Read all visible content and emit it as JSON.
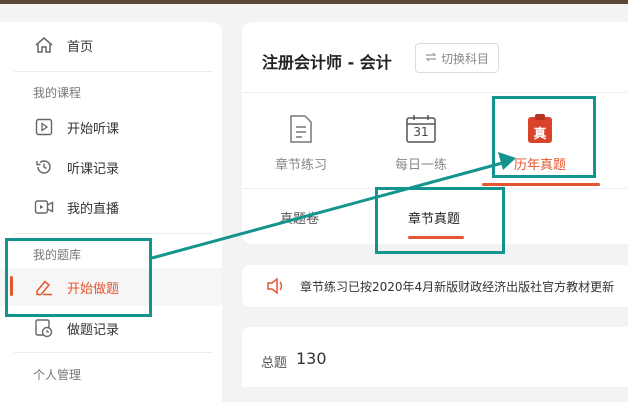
{
  "sidebar": {
    "home_label": "首页",
    "section_courses": "我的课程",
    "start_listen_label": "开始听课",
    "listen_history_label": "听课记录",
    "my_live_label": "我的直播",
    "section_question_bank": "我的题库",
    "start_practice_label": "开始做题",
    "practice_history_label": "做题记录",
    "section_personal": "个人管理"
  },
  "header": {
    "title": "注册会计师 - 会计",
    "switch_subject_label": "切换科目"
  },
  "tabs": [
    {
      "label": "章节练习",
      "icon": "document-icon"
    },
    {
      "label": "每日一练",
      "icon": "calendar-icon",
      "icon_text": "31"
    },
    {
      "label": "历年真题",
      "icon": "exam-paper-icon",
      "icon_text": "真",
      "active": true
    }
  ],
  "subtabs": [
    {
      "label": "真题卷"
    },
    {
      "label": "章节真题",
      "active": true
    }
  ],
  "notice": {
    "text": "章节练习已按2020年4月新版财政经济出版社官方教材更新"
  },
  "summary": {
    "total_label": "总题",
    "total_value": "130"
  },
  "colors": {
    "accent": "#e4572e",
    "highlight_box": "#13948e",
    "top_bar": "#5c4636"
  }
}
